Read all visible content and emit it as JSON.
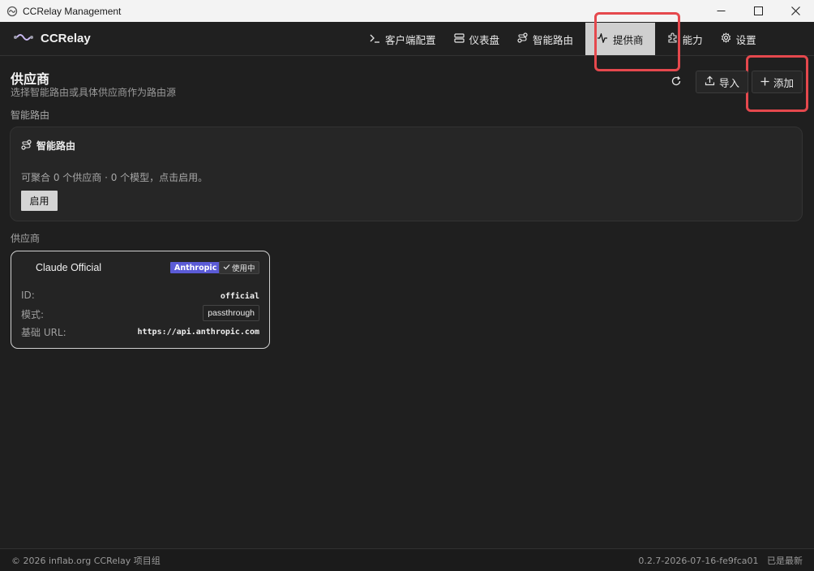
{
  "window": {
    "title": "CCRelay Management"
  },
  "brand": {
    "name": "CCRelay"
  },
  "nav": {
    "items": [
      {
        "label": "客户端配置",
        "icon": "terminal-icon"
      },
      {
        "label": "仪表盘",
        "icon": "server-icon"
      },
      {
        "label": "智能路由",
        "icon": "route-icon"
      },
      {
        "label": "提供商",
        "icon": "activity-icon",
        "active": true
      },
      {
        "label": "能力",
        "icon": "puzzle-icon"
      },
      {
        "label": "设置",
        "icon": "gear-icon"
      }
    ]
  },
  "page": {
    "title": "供应商",
    "subtitle": "选择智能路由或具体供应商作为路由源"
  },
  "actions": {
    "refresh_icon": "refresh-icon",
    "import_label": "导入",
    "add_label": "添加"
  },
  "smart_routing": {
    "section_label": "智能路由",
    "card_title": "智能路由",
    "description": "可聚合 0 个供应商 · 0 个模型，点击启用。",
    "enable_label": "启用"
  },
  "providers": {
    "section_label": "供应商",
    "items": [
      {
        "name": "Claude Official",
        "badge": "Anthropic",
        "status": "使用中",
        "id_label": "ID:",
        "id_value": "official",
        "mode_label": "模式:",
        "mode_value": "passthrough",
        "url_label": "基础 URL:",
        "url_value": "https://api.anthropic.com"
      }
    ]
  },
  "footer": {
    "left": "© 2026 inflab.org CCRelay 项目组",
    "right": "0.2.7-2026-07-16-fe9fca01   已是最新"
  },
  "colors": {
    "background": "#1f1f1f",
    "highlight": "#e5484d",
    "anthropic_badge": "#5b5bd6",
    "active_nav": "#cfcfcf"
  }
}
